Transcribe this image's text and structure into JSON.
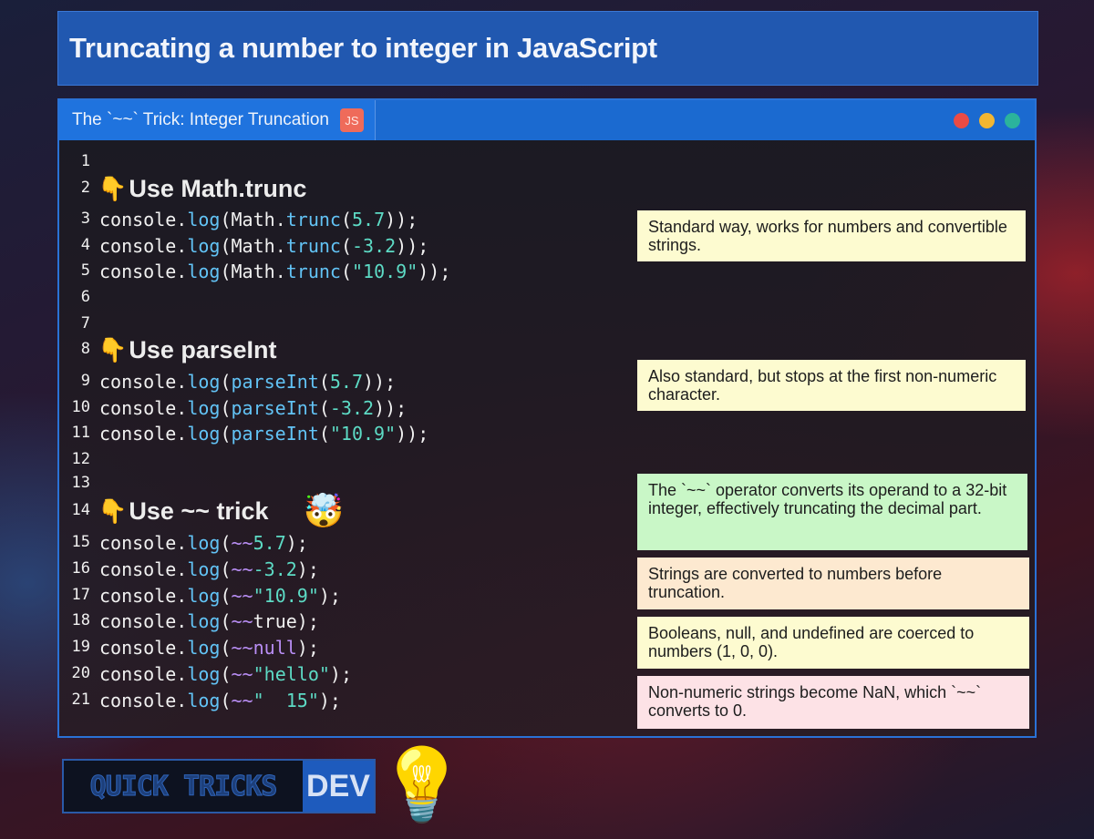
{
  "title": "Truncating a number to integer in JavaScript",
  "tab": {
    "label": "The `~~` Trick: Integer Truncation",
    "badge": "JS"
  },
  "line_numbers": [
    "1",
    "2",
    "3",
    "4",
    "5",
    "6",
    "7",
    "8",
    "9",
    "10",
    "11",
    "12",
    "13",
    "14",
    "15",
    "16",
    "17",
    "18",
    "19",
    "20",
    "21"
  ],
  "headings": {
    "h1": "Use Math.trunc",
    "h2": "Use parseInt",
    "h3": "Use ~~ trick"
  },
  "code": {
    "console": "console",
    "dot": ".",
    "log": "log",
    "math": "Math",
    "trunc": "trunc",
    "parseInt": "parseInt",
    "tilde": "~~",
    "open": "(",
    "close": ")",
    "close2": "));",
    "close1": ");",
    "v57": "5.7",
    "vneg32": "-3.2",
    "vneg32b": "-3.2",
    "s109": "\"10.9\"",
    "true": "true",
    "null": "null",
    "hello": "\"hello\"",
    "s15": "\"  15\""
  },
  "notes": {
    "n1": "Standard way, works for numbers and convertible strings.",
    "n2": "Also standard, but stops at the first non-numeric character.",
    "n3": "The `~~` operator converts its operand to a 32-bit integer, effectively truncating the decimal part.",
    "n4": "Strings are converted to numbers before truncation.",
    "n5": "Booleans, null, and undefined are coerced to numbers (1, 0, 0).",
    "n6": "Non-numeric strings become NaN, which `~~` converts to 0."
  },
  "brand": {
    "quick": "QUICK TRICKS",
    "dev": "DEV"
  },
  "icons": {
    "hand": "pointing-down-hand-icon",
    "mind_blown": "mind-blown-icon",
    "bulb": "light-bulb-icon"
  },
  "colors": {
    "title_bg": "#2158b0",
    "tab_bg": "#1b6ad0",
    "red": "#ea4b45",
    "yellow": "#f2b632",
    "green": "#2bb39c"
  }
}
